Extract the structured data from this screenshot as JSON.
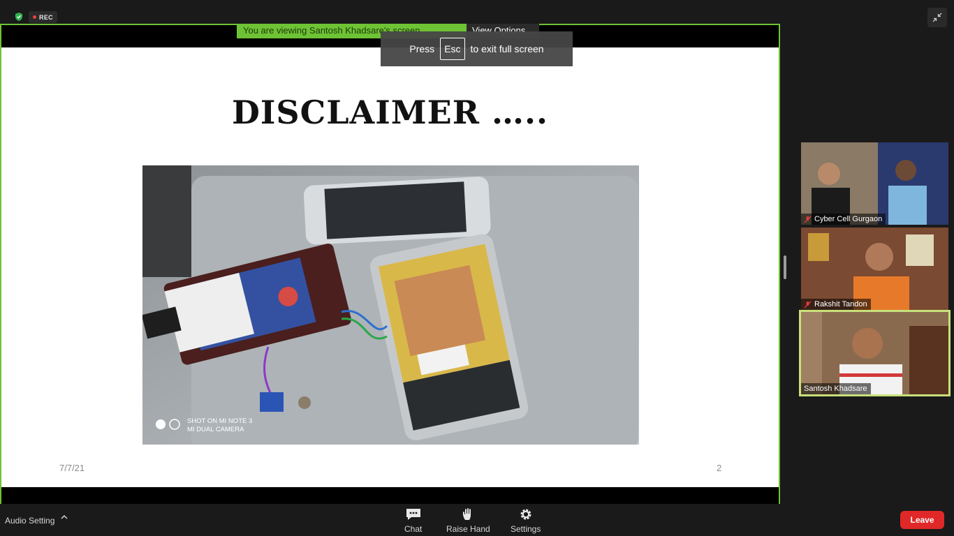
{
  "status": {
    "rec_label": "REC"
  },
  "banner": {
    "viewing_text": "You are viewing Santosh Khadsare's screen",
    "view_options_label": "View Options"
  },
  "fullscreen_toast": {
    "press": "Press",
    "key": "Esc",
    "suffix": "to exit full screen"
  },
  "slide": {
    "title": "DISCLAIMER …..",
    "date": "7/7/21",
    "page_number": "2",
    "photo_watermark_line1": "SHOT ON MI NOTE 3",
    "photo_watermark_line2": "MI DUAL CAMERA"
  },
  "participants": [
    {
      "name": "Cyber Cell Gurgaon",
      "muted": true
    },
    {
      "name": "Rakshit Tandon",
      "muted": true
    },
    {
      "name": "Santosh Khadsare",
      "muted": false,
      "active_speaker": true
    }
  ],
  "toolbar": {
    "audio_setting_label": "Audio Setting",
    "chat_label": "Chat",
    "raise_hand_label": "Raise Hand",
    "settings_label": "Settings",
    "leave_label": "Leave"
  },
  "colors": {
    "accent_green": "#6ec335",
    "leave_red": "#e02828",
    "active_border": "#c8e07a"
  }
}
